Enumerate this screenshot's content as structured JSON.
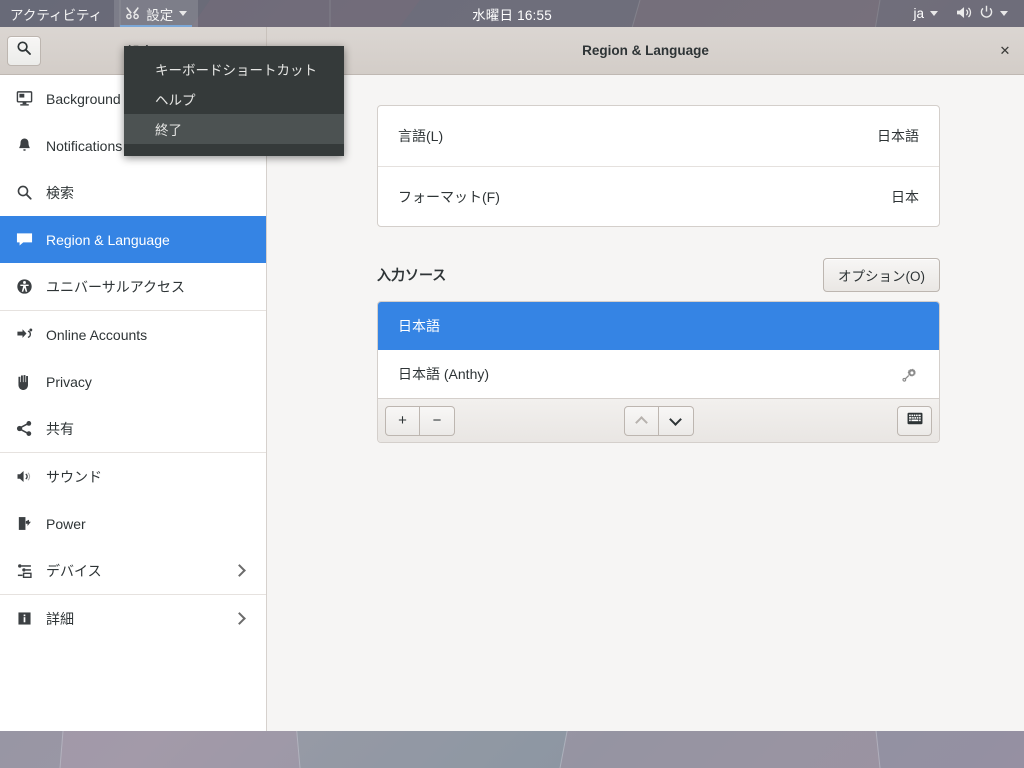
{
  "topbar": {
    "activities": "アクティビティ",
    "app_name": "設定",
    "app_icon": "settings-tools-icon",
    "clock": "水曜日 16:55",
    "keyboard_layout": "ja",
    "volume_icon": "volume-high-icon",
    "power_icon": "power-icon"
  },
  "appmenu": {
    "items": [
      {
        "label": "キーボードショートカット",
        "highlighted": false
      },
      {
        "label": "ヘルプ",
        "highlighted": false
      },
      {
        "label": "終了",
        "highlighted": true
      }
    ]
  },
  "headerbar": {
    "search_icon": "search-icon",
    "left_title": "設定",
    "title": "Region & Language",
    "close_label": "✕"
  },
  "sidebar": {
    "items": [
      {
        "label": "Background",
        "icon": "monitor-icon",
        "selected": false,
        "chevron": false
      },
      {
        "label": "Notifications",
        "icon": "bell-icon",
        "selected": false,
        "chevron": false
      },
      {
        "label": "検索",
        "icon": "search-icon",
        "selected": false,
        "chevron": false
      },
      {
        "label": "Region & Language",
        "icon": "region-language-icon",
        "selected": true,
        "chevron": false
      },
      {
        "label": "ユニバーサルアクセス",
        "icon": "accessibility-icon",
        "selected": false,
        "chevron": false
      },
      {
        "label": "Online Accounts",
        "icon": "online-accounts-icon",
        "selected": false,
        "chevron": false
      },
      {
        "label": "Privacy",
        "icon": "hand-privacy-icon",
        "selected": false,
        "chevron": false
      },
      {
        "label": "共有",
        "icon": "share-icon",
        "selected": false,
        "chevron": false
      },
      {
        "label": "サウンド",
        "icon": "speaker-icon",
        "selected": false,
        "chevron": false
      },
      {
        "label": "Power",
        "icon": "battery-power-icon",
        "selected": false,
        "chevron": false
      },
      {
        "label": "デバイス",
        "icon": "devices-icon",
        "selected": false,
        "chevron": true
      },
      {
        "label": "詳細",
        "icon": "info-icon",
        "selected": false,
        "chevron": true
      }
    ],
    "separators_after": [
      4,
      9,
      10
    ]
  },
  "main": {
    "locale_rows": [
      {
        "key": "言語(L)",
        "value": "日本語"
      },
      {
        "key": "フォーマット(F)",
        "value": "日本"
      }
    ],
    "input_sources": {
      "title": "入力ソース",
      "options_button": "オプション(O)",
      "rows": [
        {
          "name": "日本語",
          "selected": true,
          "has_cog": false
        },
        {
          "name": "日本語 (Anthy)",
          "selected": false,
          "has_cog": true,
          "cog_icon": "gear-icon"
        }
      ],
      "toolbar": {
        "add_label": "+",
        "remove_label": "−",
        "move_up_icon": "chevron-up-icon",
        "move_up_disabled": true,
        "move_down_icon": "chevron-down-icon",
        "move_down_disabled": false,
        "preview_icon": "keyboard-icon"
      }
    }
  },
  "colors": {
    "accent": "#3584e4",
    "headerbar": "#d6d1cd",
    "content_bg": "#f6f5f4",
    "card_bg": "#ffffff",
    "menu_bg": "#353a3a",
    "menu_highlight": "#4c5252"
  }
}
